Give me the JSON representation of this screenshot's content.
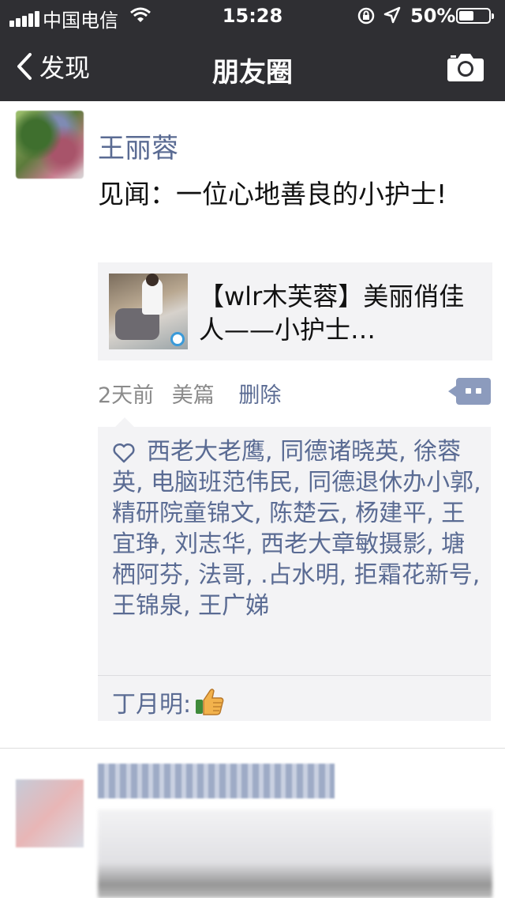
{
  "status_bar": {
    "carrier": "中国电信",
    "time": "15:28",
    "battery_percent": "50%",
    "battery_level": 0.5
  },
  "nav": {
    "back_label": "发现",
    "title": "朋友圈"
  },
  "post": {
    "author": "王丽蓉",
    "text": "见闻：一位心地善良的小护士!",
    "link_title": "【wlr木芙蓉】美丽俏佳人——小护士…",
    "time_ago": "2天前",
    "source": "美篇",
    "delete_label": "删除",
    "likes": "西老大老鹰, 同德诸晓英, 徐蓉英, 电脑班范伟民, 同德退休办小郭, 精研院童锦文, 陈楚云, 杨建平, 王宜琤, 刘志华, 西老大章敏摄影, 塘栖阿芬, 法哥, .占水明, 拒霜花新号, 王锦泉, 王广娣",
    "comment": {
      "author": "丁月明:",
      "emoji": "thumbs-up-icon"
    }
  },
  "icons": {
    "back": "chevron-left-icon",
    "camera": "camera-icon",
    "like": "heart-outline-icon",
    "comment": "comment-bubble-icon"
  },
  "colors": {
    "nav_bg": "#2f2f33",
    "link_blue": "#5a6b93",
    "card_bg": "#f3f3f5"
  }
}
